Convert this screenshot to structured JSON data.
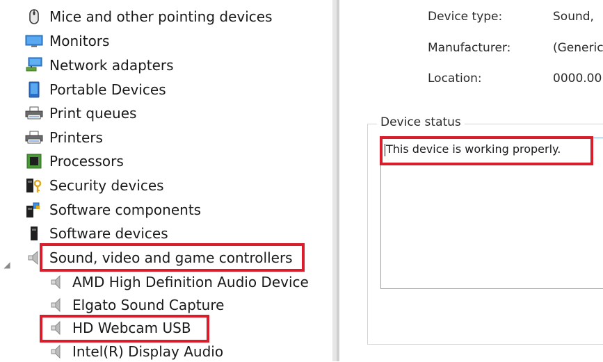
{
  "tree": {
    "categories": [
      {
        "label": "Mice and other pointing devices",
        "icon": "mouse-icon"
      },
      {
        "label": "Monitors",
        "icon": "monitor-icon"
      },
      {
        "label": "Network adapters",
        "icon": "network-adapter-icon"
      },
      {
        "label": "Portable Devices",
        "icon": "portable-device-icon"
      },
      {
        "label": "Print queues",
        "icon": "print-queue-icon"
      },
      {
        "label": "Printers",
        "icon": "printer-icon"
      },
      {
        "label": "Processors",
        "icon": "processor-icon"
      },
      {
        "label": "Security devices",
        "icon": "security-device-icon"
      },
      {
        "label": "Software components",
        "icon": "software-component-icon"
      },
      {
        "label": "Software devices",
        "icon": "software-device-icon"
      },
      {
        "label": "Sound, video and game controllers",
        "icon": "speaker-icon",
        "expanded": true
      }
    ],
    "sound_children": [
      {
        "label": "AMD High Definition Audio Device",
        "icon": "speaker-icon"
      },
      {
        "label": "Elgato Sound Capture",
        "icon": "speaker-icon"
      },
      {
        "label": "HD Webcam USB",
        "icon": "speaker-icon"
      },
      {
        "label": "Intel(R) Display Audio",
        "icon": "speaker-icon"
      }
    ]
  },
  "properties": {
    "device_type_label": "Device type:",
    "device_type_value": "Sound,",
    "manufacturer_label": "Manufacturer:",
    "manufacturer_value": "(Generic",
    "location_label": "Location:",
    "location_value": "0000.00",
    "device_status_title": "Device status",
    "device_status_text": "This device is working properly."
  },
  "colors": {
    "highlight": "#d91d2a",
    "status_box_border": "#7aa8d8"
  }
}
